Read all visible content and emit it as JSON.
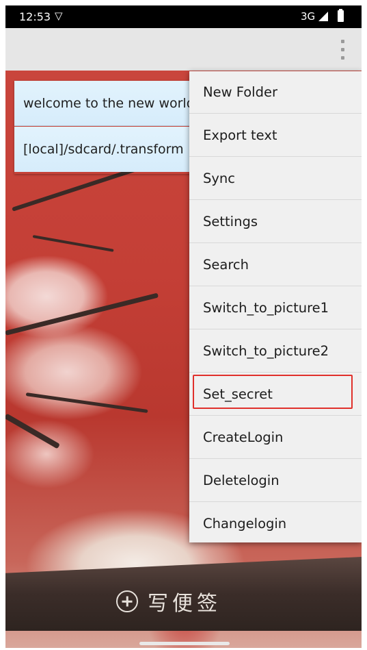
{
  "status_bar": {
    "time": "12:53",
    "network": "3G",
    "icons": [
      "vpn-icon",
      "signal-icon",
      "battery-icon"
    ]
  },
  "action_bar": {
    "overflow_icon": "more-vert-icon"
  },
  "list": {
    "items": [
      {
        "text": "welcome to the new world"
      },
      {
        "text": "[local]/sdcard/.transform"
      }
    ]
  },
  "bottom": {
    "write_label": "写便签",
    "write_icon": "add-circle-icon"
  },
  "menu": {
    "items": [
      {
        "label": "New Folder"
      },
      {
        "label": "Export text"
      },
      {
        "label": "Sync"
      },
      {
        "label": "Settings"
      },
      {
        "label": "Search"
      },
      {
        "label": "Switch_to_picture1"
      },
      {
        "label": "Switch_to_picture2"
      },
      {
        "label": "Set_secret"
      },
      {
        "label": "CreateLogin"
      },
      {
        "label": "Deletelogin"
      },
      {
        "label": "Changelogin"
      }
    ],
    "highlighted_item": "Set_secret",
    "highlight_color": "#e0302b"
  }
}
